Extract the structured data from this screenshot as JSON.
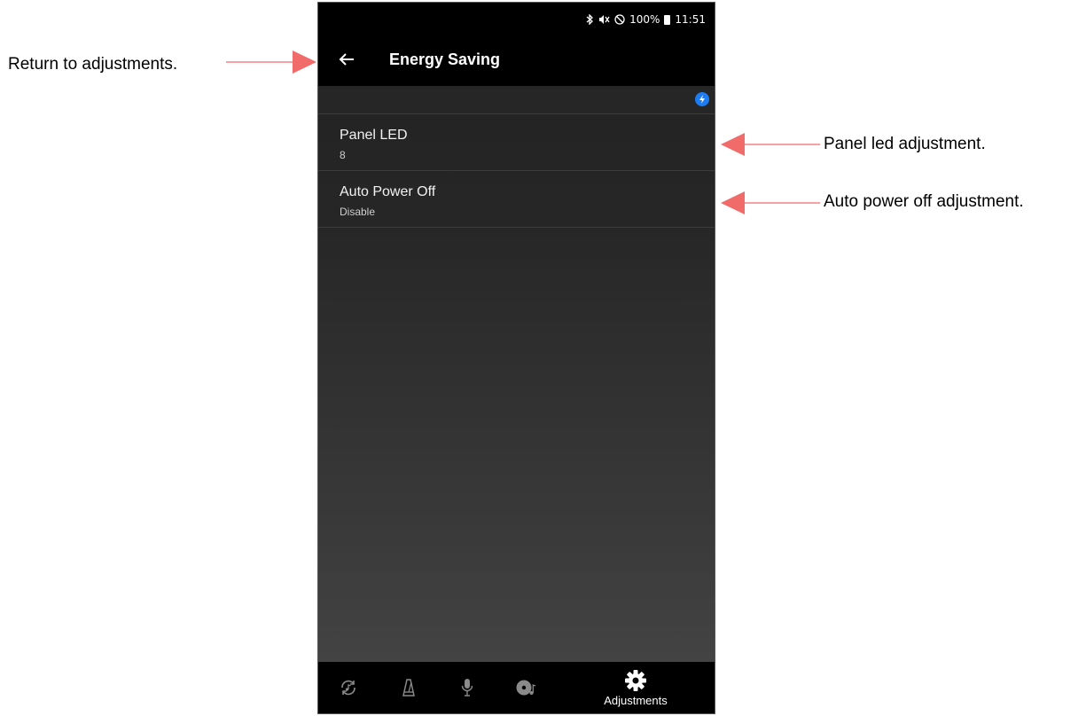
{
  "status_bar": {
    "battery_percent": "100%",
    "time": "11:51",
    "icons": [
      "bluetooth-icon",
      "mute-icon",
      "do-not-disturb-icon",
      "battery-icon"
    ]
  },
  "app_bar": {
    "back_icon": "arrow-left-icon",
    "title": "Energy Saving"
  },
  "connection": {
    "icon": "bluetooth-connected-icon",
    "accent_color": "#1e7cf2"
  },
  "settings": [
    {
      "label": "Panel LED",
      "value": "8"
    },
    {
      "label": "Auto Power Off",
      "value": "Disable"
    }
  ],
  "bottom_nav": {
    "items": [
      {
        "icon": "music-sync-icon",
        "label": ""
      },
      {
        "icon": "metronome-icon",
        "label": ""
      },
      {
        "icon": "microphone-icon",
        "label": ""
      },
      {
        "icon": "disc-music-icon",
        "label": ""
      },
      {
        "icon": "gear-icon",
        "label": "Adjustments",
        "active": true
      }
    ]
  },
  "annotations": {
    "return": "Return to adjustments.",
    "panel_led": "Panel led adjustment.",
    "auto_power_off": "Auto power off adjustment.",
    "arrow_color": "#f26b6b"
  }
}
